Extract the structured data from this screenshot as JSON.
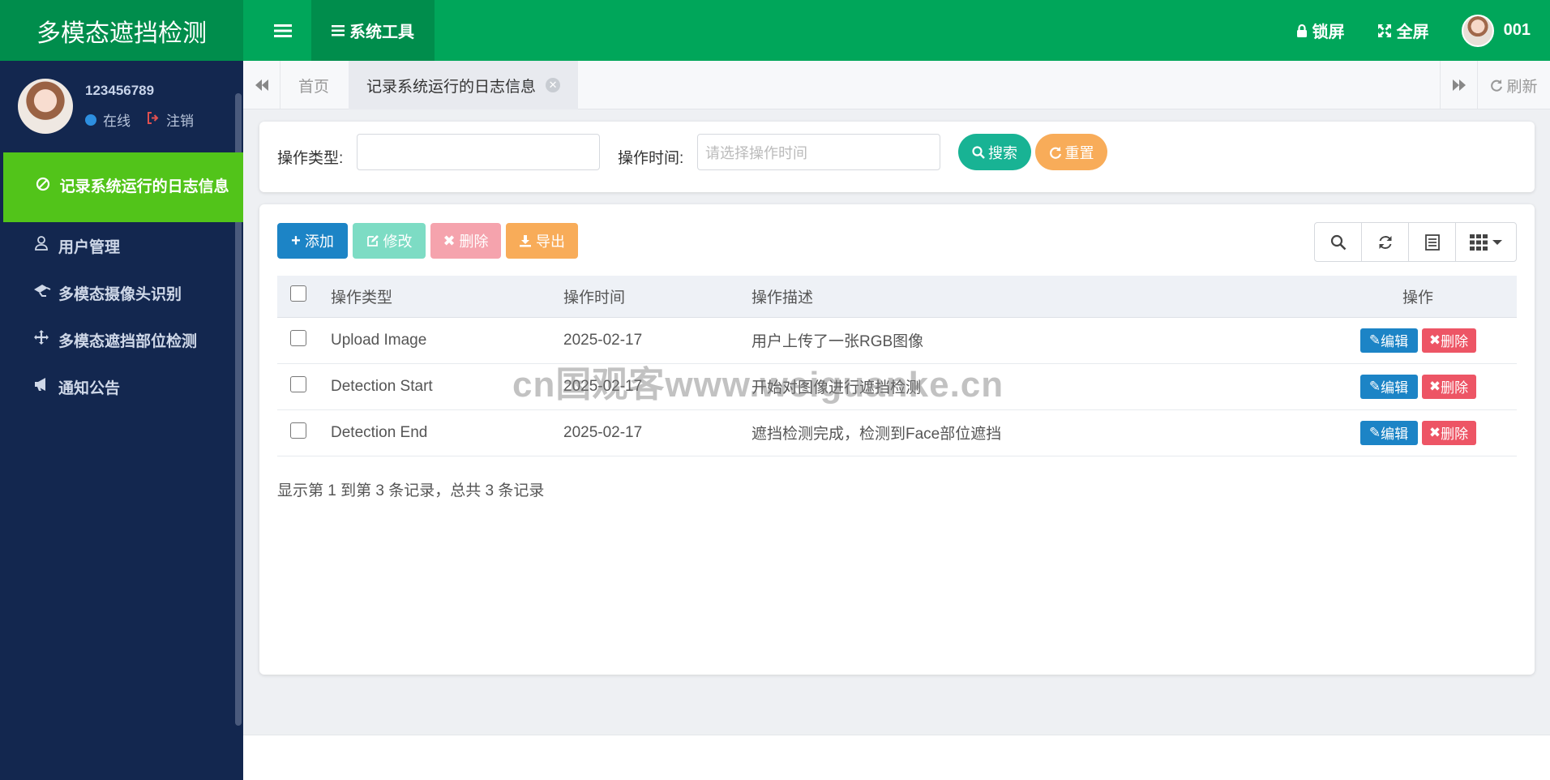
{
  "header": {
    "app_title": "多模态遮挡检测",
    "menu_toggle_icon": "bars-icon",
    "system_tools_label": "系统工具",
    "lock_label": "锁屏",
    "fullscreen_label": "全屏",
    "user_label": "001",
    "bg_color": "#00a65a"
  },
  "sidebar": {
    "username": "123456789",
    "status_label": "在线",
    "logout_label": "注销",
    "items": [
      {
        "label": "记录系统运行的日志信息",
        "icon": "ban-icon",
        "active": true
      },
      {
        "label": "用户管理",
        "icon": "user-icon"
      },
      {
        "label": "多模态摄像头识别",
        "icon": "camera-icon"
      },
      {
        "label": "多模态遮挡部位检测",
        "icon": "arrows-icon"
      },
      {
        "label": "通知公告",
        "icon": "bullhorn-icon"
      }
    ],
    "active_color": "#52c41a",
    "bg_color": "#13274f"
  },
  "tabs": {
    "home_label": "首页",
    "active_label": "记录系统运行的日志信息",
    "refresh_label": "刷新"
  },
  "search": {
    "op_type_label": "操作类型:",
    "op_type_value": "",
    "op_time_label": "操作时间:",
    "op_time_placeholder": "请选择操作时间",
    "search_button": "搜索",
    "reset_button": "重置"
  },
  "toolbar": {
    "add_label": "添加",
    "edit_label": "修改",
    "delete_label": "删除",
    "export_label": "导出"
  },
  "table": {
    "headers": {
      "type": "操作类型",
      "time": "操作时间",
      "desc": "操作描述",
      "op": "操作"
    },
    "rows": [
      {
        "type": "Upload Image",
        "time": "2025-02-17",
        "desc": "用户上传了一张RGB图像"
      },
      {
        "type": "Detection Start",
        "time": "2025-02-17",
        "desc": "开始对图像进行遮挡检测"
      },
      {
        "type": "Detection End",
        "time": "2025-02-17",
        "desc": "遮挡检测完成，检测到Face部位遮挡"
      }
    ],
    "row_edit_label": "编辑",
    "row_delete_label": "删除",
    "pager_info": "显示第 1 到第 3 条记录，总共 3 条记录"
  },
  "watermark": "cn国观客www.weiguanke.cn"
}
